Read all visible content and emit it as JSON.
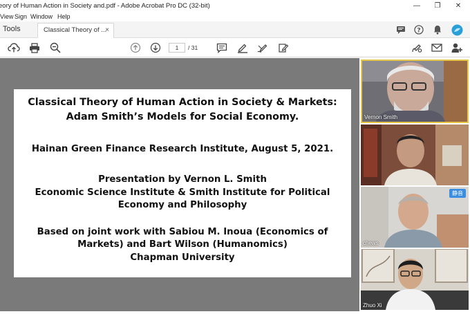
{
  "window": {
    "title": "eory of Human Action in Society and.pdf - Adobe Acrobat Pro DC (32-bit)",
    "minimize": "—",
    "restore": "❐",
    "close": "✕"
  },
  "menu": {
    "items": [
      "View",
      "Sign",
      "Window",
      "Help"
    ]
  },
  "tabs": {
    "tools": "Tools",
    "document": "Classical Theory of ...",
    "close": "×"
  },
  "toolbar": {
    "page_current": "1",
    "page_total": "/ 31"
  },
  "slide": {
    "title_line1": "Classical Theory of Human Action in Society & Markets:",
    "title_line2": "Adam Smith’s Models for Social Economy.",
    "venue": "Hainan Green Finance Research Institute, August 5, 2021.",
    "presenter": "Presentation by Vernon L. Smith",
    "affiliation_line1": "Economic Science Institute & Smith Institute for Political",
    "affiliation_line2": "Economy and Philosophy",
    "joint_line1": "Based on joint work with Sabiou M. Inoua (Economics of",
    "joint_line2": "Markets) and Bart Wilson (Humanomics)",
    "university": "Chapman University"
  },
  "participants": [
    {
      "name": "Vernon Smith"
    },
    {
      "name": ""
    },
    {
      "name": "chews",
      "badge": "静音"
    },
    {
      "name": "Zhuo Xi"
    }
  ],
  "colors": {
    "viewer_bg": "#7a7a7a",
    "active_speaker_border": "#e8c84a",
    "badge_blue": "#3a8de0"
  }
}
